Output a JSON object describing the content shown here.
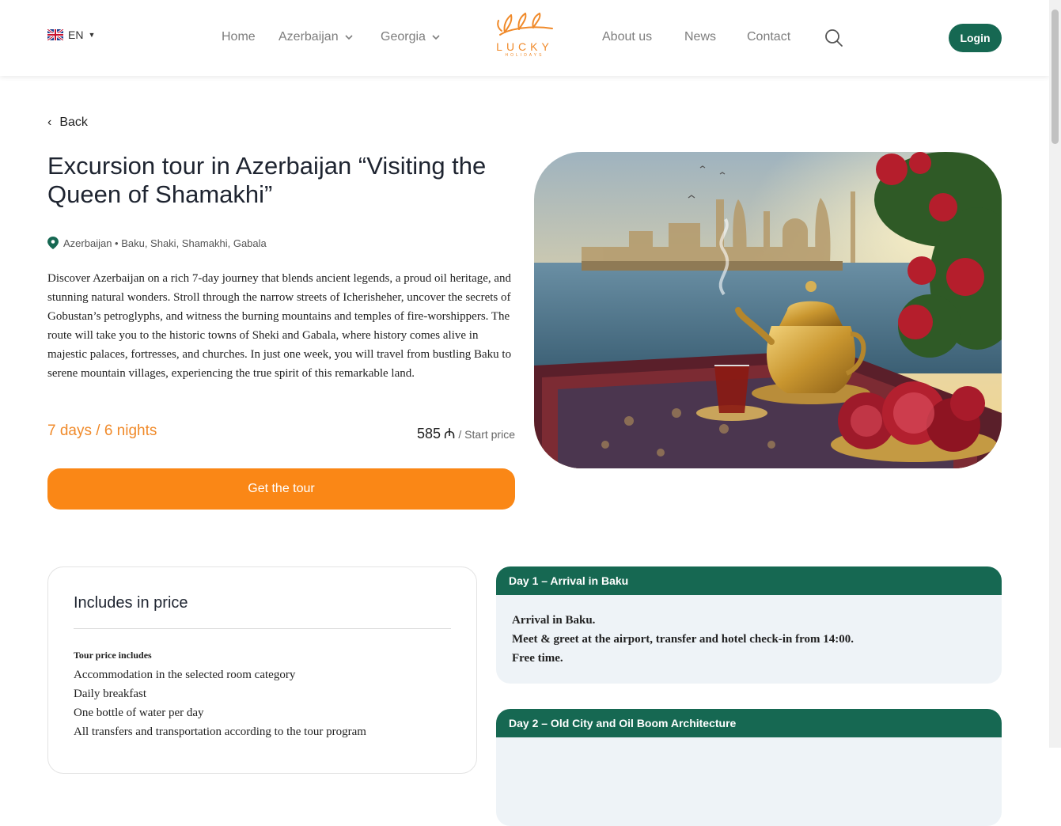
{
  "header": {
    "language": "EN",
    "nav": {
      "home": "Home",
      "azerbaijan": "Azerbaijan",
      "georgia": "Georgia",
      "about": "About us",
      "news": "News",
      "contact": "Contact"
    },
    "logo": {
      "word": "LUCKY",
      "sub": "HOLIDAYS"
    },
    "login": "Login"
  },
  "back": "Back",
  "tour": {
    "title": "Excursion tour in Azerbaijan “Visiting the Queen of Shamakhi”",
    "location": "Azerbaijan • Baku, Shaki, Shamakhi, Gabala",
    "description": "Discover Azerbaijan on a rich 7-day journey that blends ancient legends, a proud oil heritage, and stunning natural wonders. Stroll through the narrow streets of Icherisheher, uncover the secrets of Gobustan’s petroglyphs, and witness the burning mountains and temples of fire-worshippers. The route will take you to the historic towns of Sheki and Gabala, where history comes alive in majestic palaces, fortresses, and churches. In just one week, you will travel from bustling Baku to serene mountain villages, experiencing the true spirit of this remarkable land.",
    "duration": "7 days / 6 nights",
    "price": "585",
    "currency": "₼",
    "price_label": "/ Start price",
    "cta": "Get the tour"
  },
  "includes": {
    "title": "Includes in price",
    "subtitle": "Tour price includes",
    "items": [
      "Accommodation in the selected room category",
      "Daily breakfast",
      "One bottle of water per day",
      "All transfers and transportation according to the tour program"
    ]
  },
  "days": [
    {
      "title": "Day 1 – Arrival in Baku",
      "lines": [
        "Arrival in Baku.",
        "Meet & greet at the airport, transfer and hotel check-in from 14:00.",
        "Free time."
      ]
    },
    {
      "title": "Day 2 – Old City and Oil Boom Architecture",
      "lines": []
    }
  ],
  "colors": {
    "brand_green": "#166852",
    "accent_orange": "#fa8716"
  }
}
